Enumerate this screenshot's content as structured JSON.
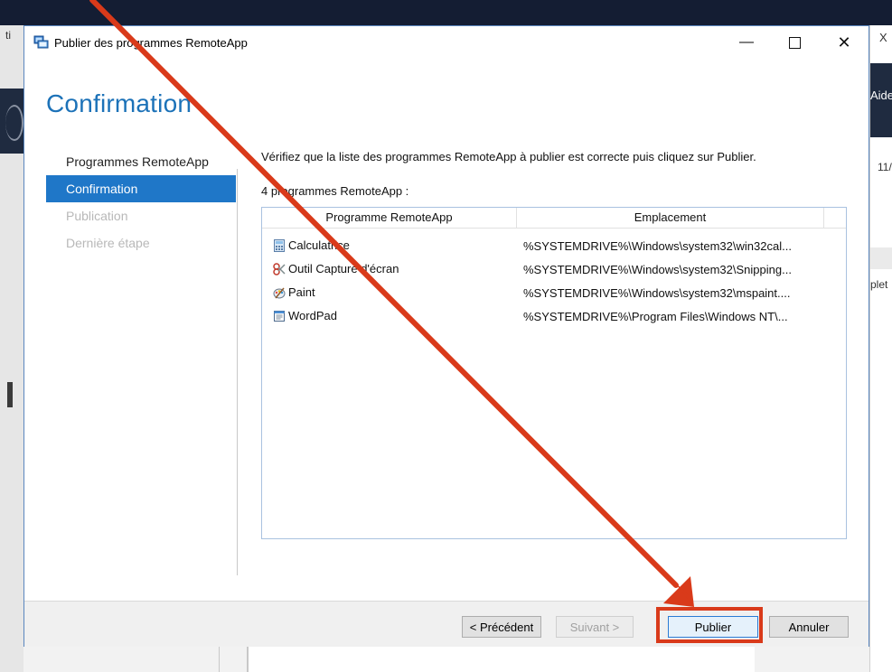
{
  "background": {
    "left_tab_text": "ti",
    "right_close": "X",
    "right_help": "Aide",
    "right_date": "11/",
    "right_completed": "plet"
  },
  "dialog": {
    "title": "Publier des programmes RemoteApp",
    "controls": {
      "minimize": "—",
      "close": "✕"
    },
    "heading": "Confirmation"
  },
  "nav": {
    "items": [
      {
        "label": "Programmes RemoteApp",
        "state": "normal"
      },
      {
        "label": "Confirmation",
        "state": "active"
      },
      {
        "label": "Publication",
        "state": "disabled"
      },
      {
        "label": "Dernière étape",
        "state": "disabled"
      }
    ]
  },
  "content": {
    "instruction": "Vérifiez que la liste des programmes RemoteApp à publier est correcte puis cliquez sur Publier.",
    "count_label": "4 programmes RemoteApp :",
    "columns": [
      "Programme RemoteApp",
      "Emplacement"
    ],
    "rows": [
      {
        "name": "Calculatrice",
        "path": "%SYSTEMDRIVE%\\Windows\\system32\\win32cal...",
        "icon": "calculator-icon"
      },
      {
        "name": "Outil Capture d'écran",
        "path": "%SYSTEMDRIVE%\\Windows\\system32\\Snipping...",
        "icon": "snipping-tool-icon"
      },
      {
        "name": "Paint",
        "path": "%SYSTEMDRIVE%\\Windows\\system32\\mspaint....",
        "icon": "paint-icon"
      },
      {
        "name": "WordPad",
        "path": "%SYSTEMDRIVE%\\Program Files\\Windows NT\\...",
        "icon": "wordpad-icon"
      }
    ]
  },
  "footer": {
    "previous": "< Précédent",
    "next": "Suivant >",
    "publish": "Publier",
    "cancel": "Annuler"
  },
  "annotation": {
    "color": "#d93a1a"
  }
}
